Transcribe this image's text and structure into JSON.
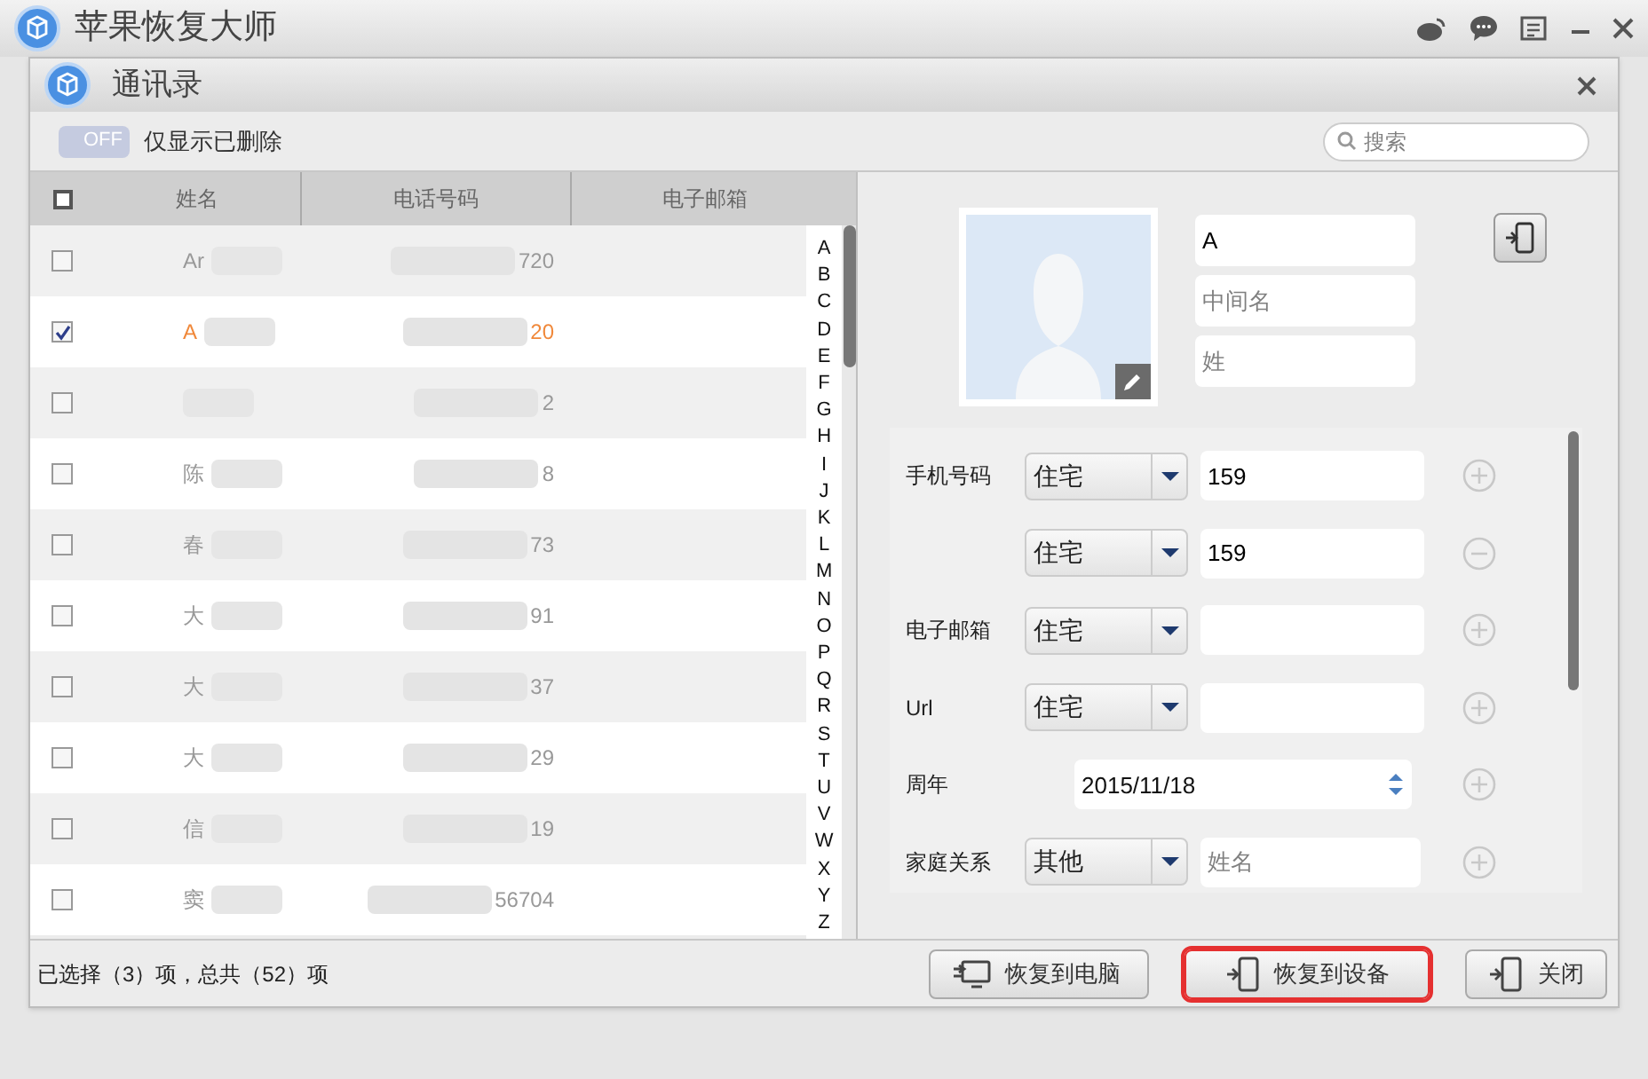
{
  "app": {
    "title": "苹果恢复大师"
  },
  "dialog": {
    "title": "通讯录"
  },
  "filter": {
    "toggle": "OFF",
    "on": false,
    "label": "仅显示已删除"
  },
  "search": {
    "placeholder": "搜索"
  },
  "table": {
    "columns": [
      "姓名",
      "电话号码",
      "电子邮箱"
    ],
    "select_all": false,
    "rows": [
      {
        "name": "Ar",
        "phone": "720",
        "checked": false
      },
      {
        "name": "A",
        "phone": "20",
        "checked": true
      },
      {
        "name": "",
        "phone": "2",
        "checked": false
      },
      {
        "name": "陈",
        "phone": "8",
        "checked": false
      },
      {
        "name": "春",
        "phone": "73",
        "checked": false
      },
      {
        "name": "大",
        "phone": "91",
        "checked": false
      },
      {
        "name": "大",
        "phone": "37",
        "checked": false
      },
      {
        "name": "大",
        "phone": "29",
        "checked": false
      },
      {
        "name": "信",
        "phone": "19",
        "checked": false
      },
      {
        "name": "窦",
        "phone": "56704",
        "checked": false
      }
    ]
  },
  "index": [
    "A",
    "B",
    "C",
    "D",
    "E",
    "F",
    "G",
    "H",
    "I",
    "J",
    "K",
    "L",
    "M",
    "N",
    "O",
    "P",
    "Q",
    "R",
    "S",
    "T",
    "U",
    "V",
    "W",
    "X",
    "Y",
    "Z"
  ],
  "contact": {
    "first_name": "A",
    "middle_placeholder": "中间名",
    "last_placeholder": "姓",
    "fields": [
      {
        "kind": "select",
        "label": "手机号码",
        "type": "住宅",
        "value": "159",
        "removable": false
      },
      {
        "kind": "select",
        "type": "住宅",
        "value": "159",
        "removable": true
      },
      {
        "kind": "select",
        "label": "电子邮箱",
        "type": "住宅",
        "removable": false
      },
      {
        "kind": "select",
        "label": "Url",
        "type": "住宅",
        "removable": false
      },
      {
        "kind": "date",
        "label": "周年",
        "value": "2015/11/18",
        "removable": false
      },
      {
        "kind": "select",
        "label": "家庭关系",
        "type": "其他",
        "placeholder": "姓名",
        "removable": false
      }
    ]
  },
  "status": "已选择（3）项，总共（52）项",
  "buttons": [
    {
      "label": "恢复到电脑",
      "highlighted": false
    },
    {
      "label": "恢复到设备",
      "highlighted": true
    },
    {
      "label": "关闭",
      "highlighted": false
    }
  ]
}
